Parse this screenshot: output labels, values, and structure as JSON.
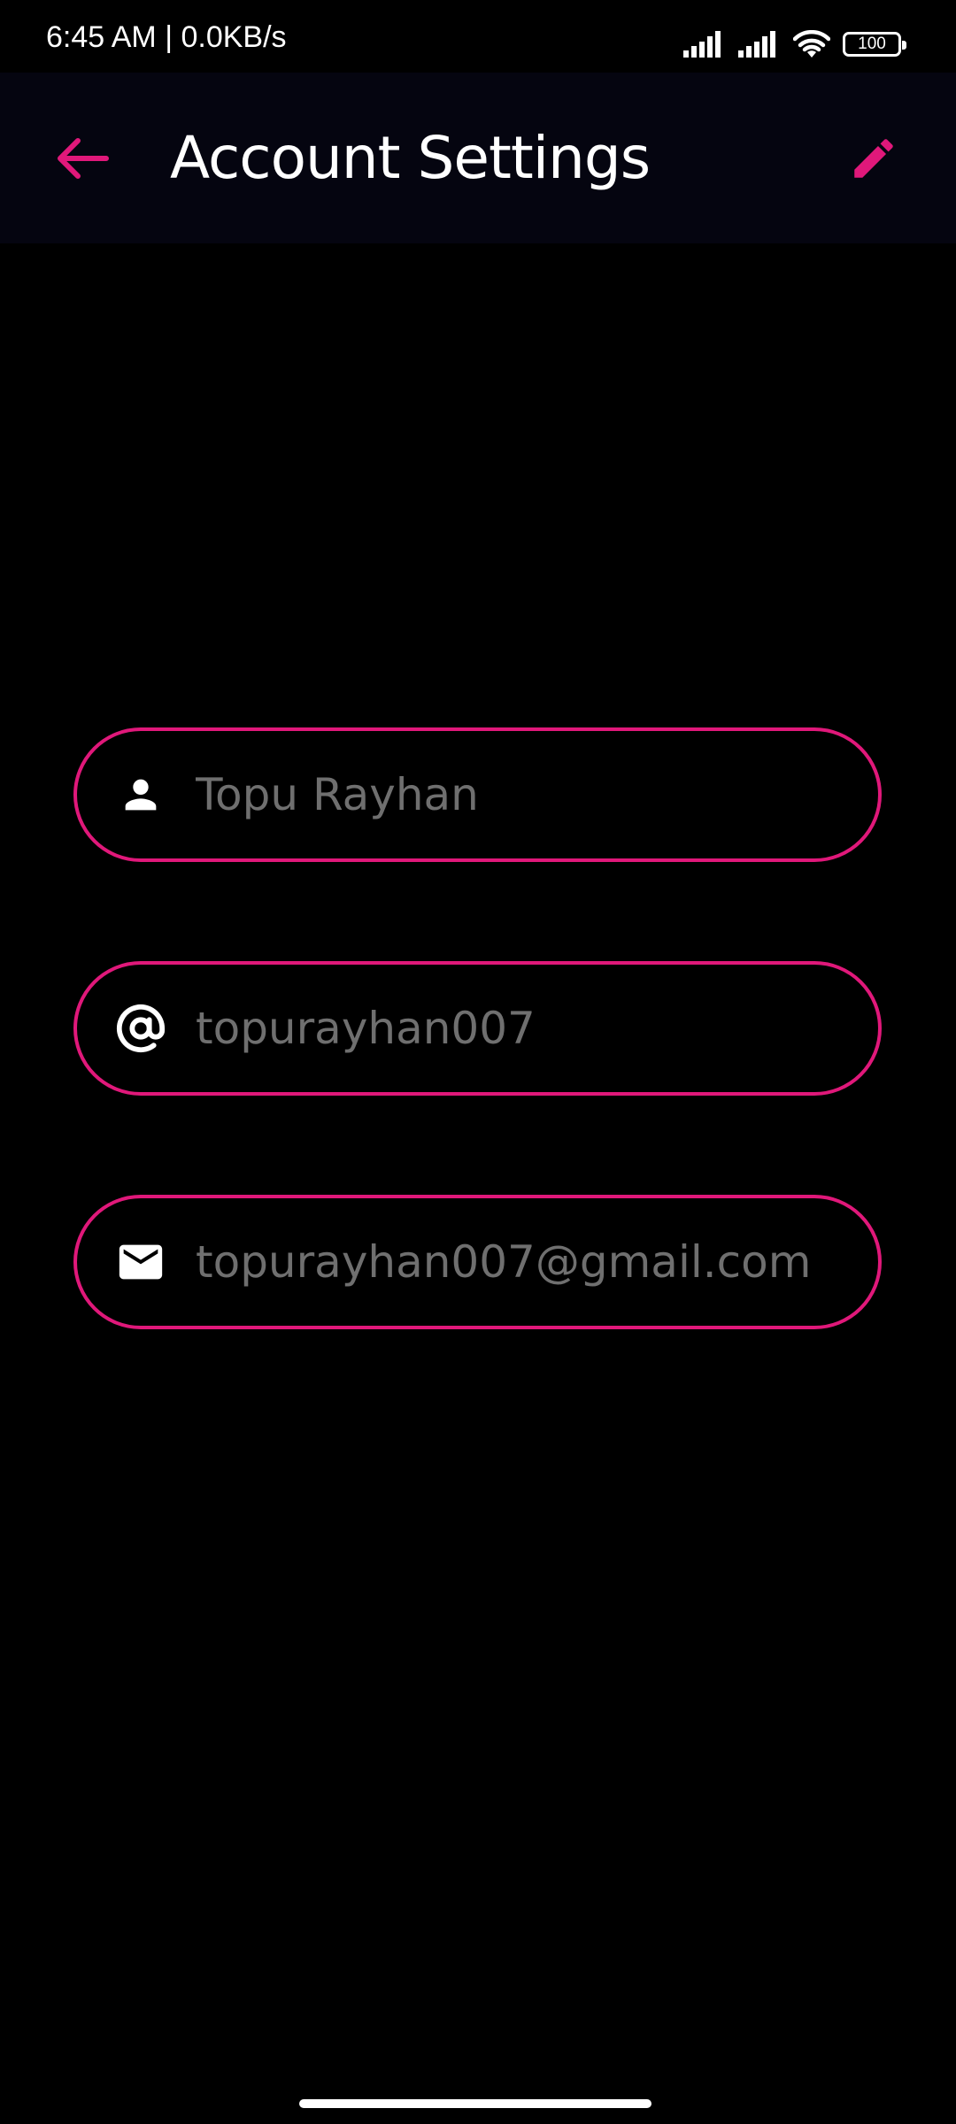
{
  "status_bar": {
    "time_speed": "6:45 AM | 0.0KB/s",
    "battery_level": "100",
    "icons": [
      "signal-icon",
      "signal-icon",
      "wifi-icon",
      "battery-icon"
    ]
  },
  "app_bar": {
    "title": "Account Settings",
    "back_icon": "arrow-left-icon",
    "edit_icon": "pencil-icon"
  },
  "form": {
    "name": {
      "icon": "person-icon",
      "value": "Topu Rayhan"
    },
    "username": {
      "icon": "at-sign-icon",
      "value": "topurayhan007"
    },
    "email": {
      "icon": "mail-icon",
      "value": "topurayhan007@gmail.com"
    }
  },
  "colors": {
    "accent": "#e0187a",
    "background": "#000000",
    "app_bar_background": "#050510",
    "field_text": "#6f6f6f",
    "title_text": "#ffffff"
  }
}
